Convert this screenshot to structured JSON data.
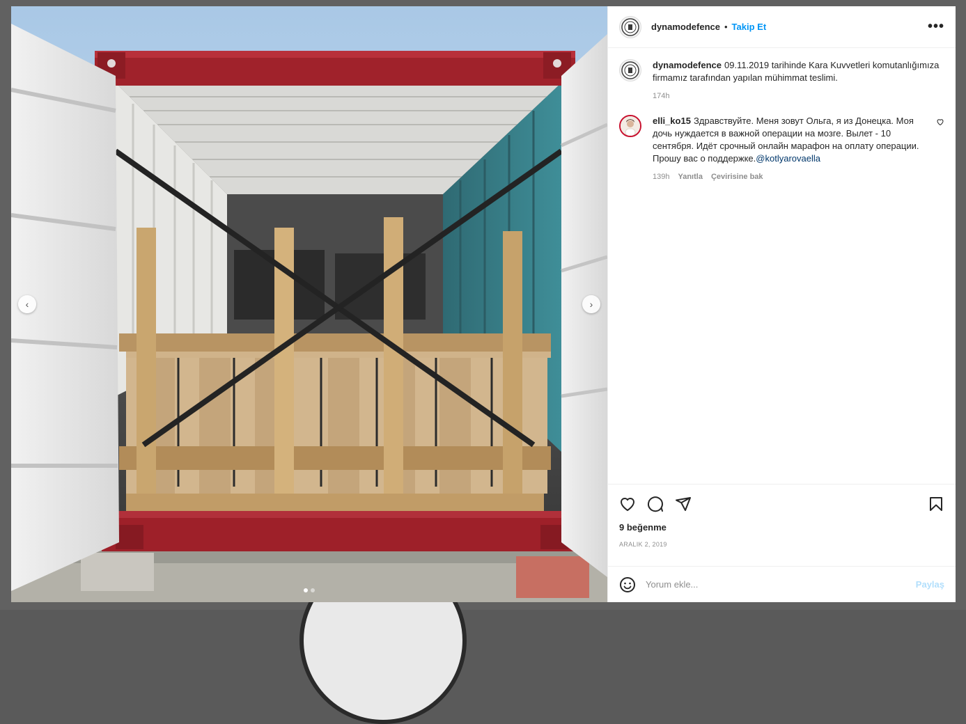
{
  "header": {
    "username": "dynamodefence",
    "separator": "•",
    "follow_label": "Takip Et",
    "more_icon": "more-horizontal-icon"
  },
  "caption": {
    "username": "dynamodefence",
    "text": "09.11.2019 tarihinde Kara Kuvvetleri komutanlığımıza firmamız tarafından yapılan mühimmat teslimi.",
    "time": "174h"
  },
  "comments": [
    {
      "username": "elli_ko15",
      "text": "Здравствуйте. Меня зовут Ольга, я из Донецка. Моя дочь нуждается в важной операции на мозге. Вылет - 10 сентября. Идёт срочный онлайн марафон на оплату операции. Прошу вас о поддержке.",
      "mention": "@kotlyarovaella",
      "time": "139h",
      "reply_label": "Yanıtla",
      "translate_label": "Çevirisine bak"
    }
  ],
  "actions": {
    "like_icon": "heart-icon",
    "comment_icon": "comment-icon",
    "share_icon": "send-icon",
    "save_icon": "bookmark-icon"
  },
  "likes_label": "9 beğenme",
  "date_label": "ARALIK 2, 2019",
  "add_comment": {
    "placeholder": "Yorum ekle...",
    "submit_label": "Paylaş",
    "emoji_icon": "emoji-icon"
  },
  "media": {
    "prev_icon": "chevron-left-icon",
    "next_icon": "chevron-right-icon",
    "slide_count": 2,
    "active_slide": 1
  }
}
